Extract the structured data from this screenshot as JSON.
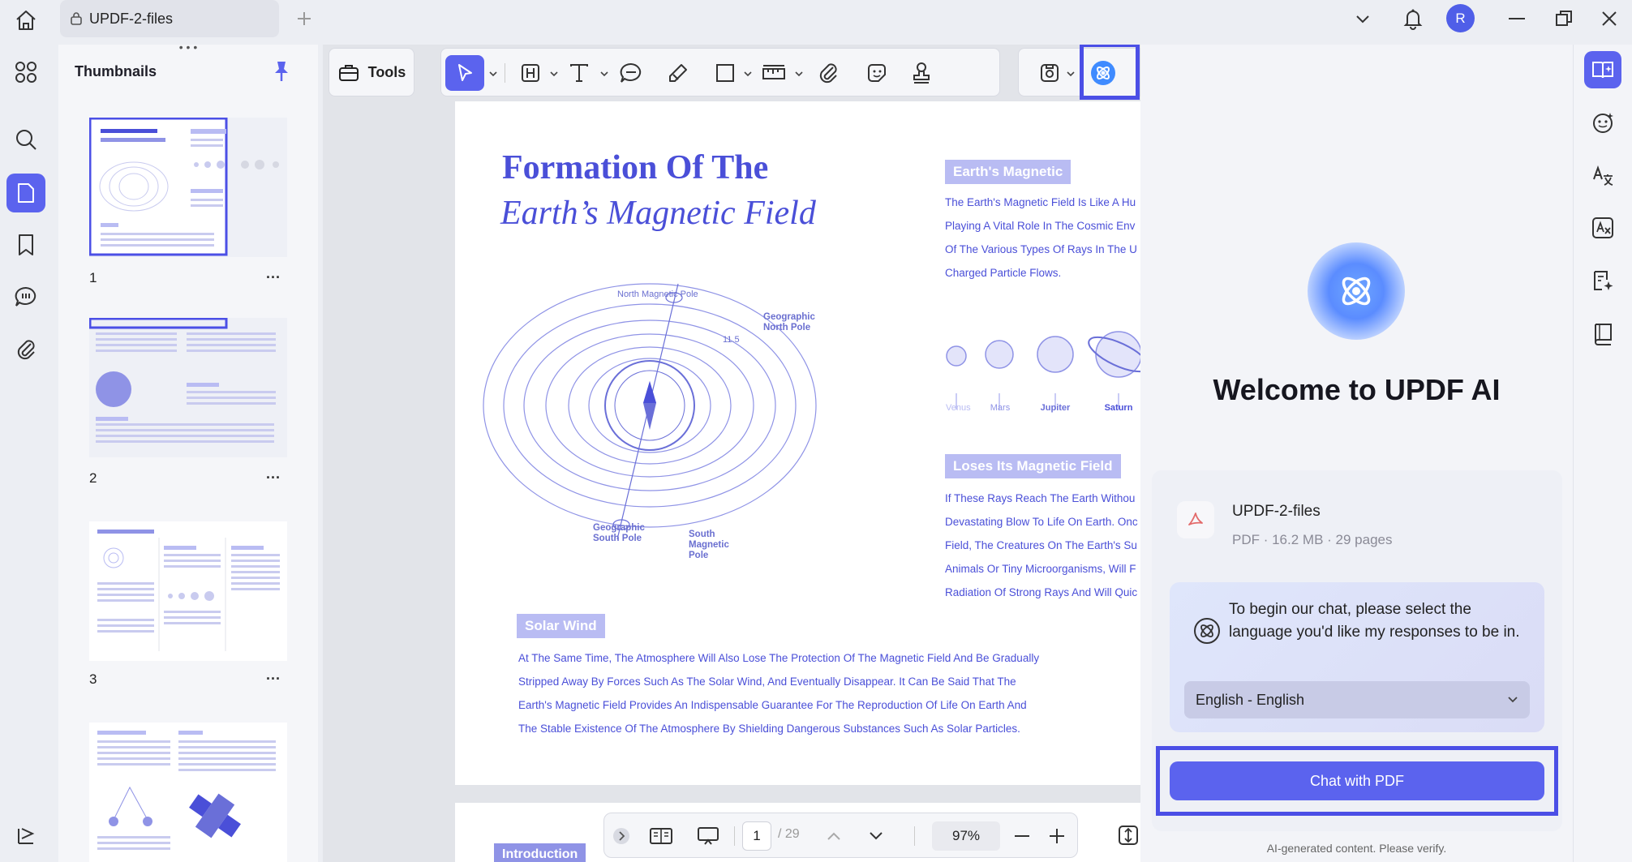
{
  "tab": {
    "title": "UPDF-2-files"
  },
  "user": {
    "initial": "R"
  },
  "thumbnails": {
    "title": "Thumbnails",
    "pages": [
      {
        "number": "1",
        "more": "..."
      },
      {
        "number": "2",
        "more": "..."
      },
      {
        "number": "3",
        "more": "..."
      }
    ]
  },
  "toolbar": {
    "tools_label": "Tools"
  },
  "document": {
    "title_line1": "Formation Of The",
    "title_line2": "Earth’s Magnetic Field",
    "diagram_labels": {
      "north_magnetic_pole": "North Magnetic Pole",
      "geographic_north_pole": "Geographic North Pole",
      "angle": "11.5",
      "geographic_south_pole": "Geographic South Pole",
      "south_magnetic_pole": "South Magnetic Pole"
    },
    "section1": {
      "tag": "Earth's Magnetic",
      "lines": [
        "The Earth's Magnetic Field Is Like A Hu",
        "Playing A Vital Role In The Cosmic Env",
        "Of The Various Types Of Rays In The U",
        "Charged Particle Flows."
      ]
    },
    "planets": [
      "Venus",
      "Mars",
      "Jupiter",
      "Saturn"
    ],
    "section2": {
      "tag": "Loses Its Magnetic Field",
      "lines": [
        "If These Rays Reach The Earth Withou",
        "Devastating Blow To Life On Earth. Onc",
        "Field, The Creatures On The Earth's Su",
        "Animals Or Tiny Microorganisms, Will F",
        "Radiation Of Strong Rays And Will Quic"
      ]
    },
    "section3": {
      "tag": "Solar Wind",
      "lines": [
        "At The Same Time, The Atmosphere Will Also Lose The Protection Of The Magnetic Field And Be Gradually",
        "Stripped Away By Forces Such As The Solar Wind, And Eventually Disappear. It Can Be Said That The",
        "Earth's Magnetic Field Provides An Indispensable Guarantee For The Reproduction Of Life On Earth And",
        "The Stable Existence Of The Atmosphere By Shielding Dangerous Substances Such As Solar Particles."
      ]
    },
    "page2_tag": "Introduction"
  },
  "bottombar": {
    "current_page": "1",
    "total_pages": "/ 29",
    "zoom": "97%"
  },
  "ai": {
    "welcome": "Welcome to UPDF AI",
    "file_name": "UPDF-2-files",
    "file_meta": "PDF · 16.2 MB · 29 pages",
    "lang_prompt": "To begin our chat, please select the language you'd like my responses to be in.",
    "lang_selected": "English - English",
    "chat_button": "Chat with PDF",
    "disclaimer": "AI-generated content. Please verify."
  },
  "colors": {
    "accent": "#5b63ee",
    "doc_blue": "#4a4fd8",
    "highlight": "#4b4fe6"
  }
}
